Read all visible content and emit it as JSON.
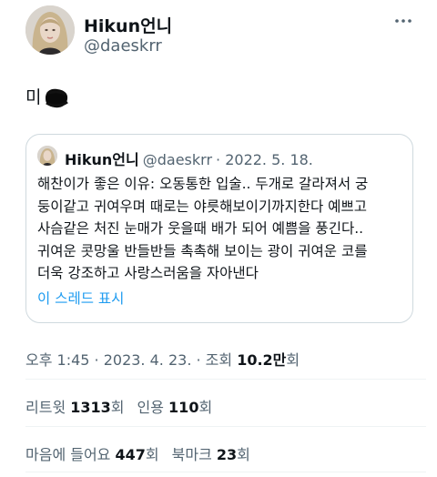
{
  "tweet": {
    "display_name": "Hikun언니",
    "handle": "@daeskrr",
    "text_prefix": "미",
    "more_icon": "more-horizontal-icon"
  },
  "quote": {
    "display_name": "Hikun언니",
    "handle": "@daeskrr",
    "date": "· 2022. 5. 18.",
    "lines": [
      "해찬이가 좋은 이유: 오동통한 입술.. 두개로 갈라져서 궁",
      "둥이같고 귀여우며 때로는 야릇해보이기까지한다 예쁘고",
      "사슴같은 처진 눈매가 웃을때 배가 되어 예쁨을 풍긴다..",
      "귀여운 콧망울 반들반들 촉촉해 보이는 광이 귀여운 코를",
      "더욱 강조하고 사랑스러움을 자아낸다"
    ],
    "show_thread": "이 스레드 표시"
  },
  "meta": {
    "time_date": "오후 1:45 · 2023. 4. 23. · 조회 ",
    "views_value": "10.2만",
    "views_suffix": "회"
  },
  "stats": {
    "retweets_label": "리트윗 ",
    "retweets_value": "1313",
    "retweets_suffix": "회",
    "quotes_label": "인용 ",
    "quotes_value": "110",
    "quotes_suffix": "회",
    "likes_label": "마음에 들어요 ",
    "likes_value": "447",
    "likes_suffix": "회",
    "bookmarks_label": "북마크 ",
    "bookmarks_value": "23",
    "bookmarks_suffix": "회"
  },
  "colors": {
    "text_primary": "#0f1419",
    "text_secondary": "#536471",
    "link": "#1d9bf0",
    "border": "#cfd9de"
  }
}
